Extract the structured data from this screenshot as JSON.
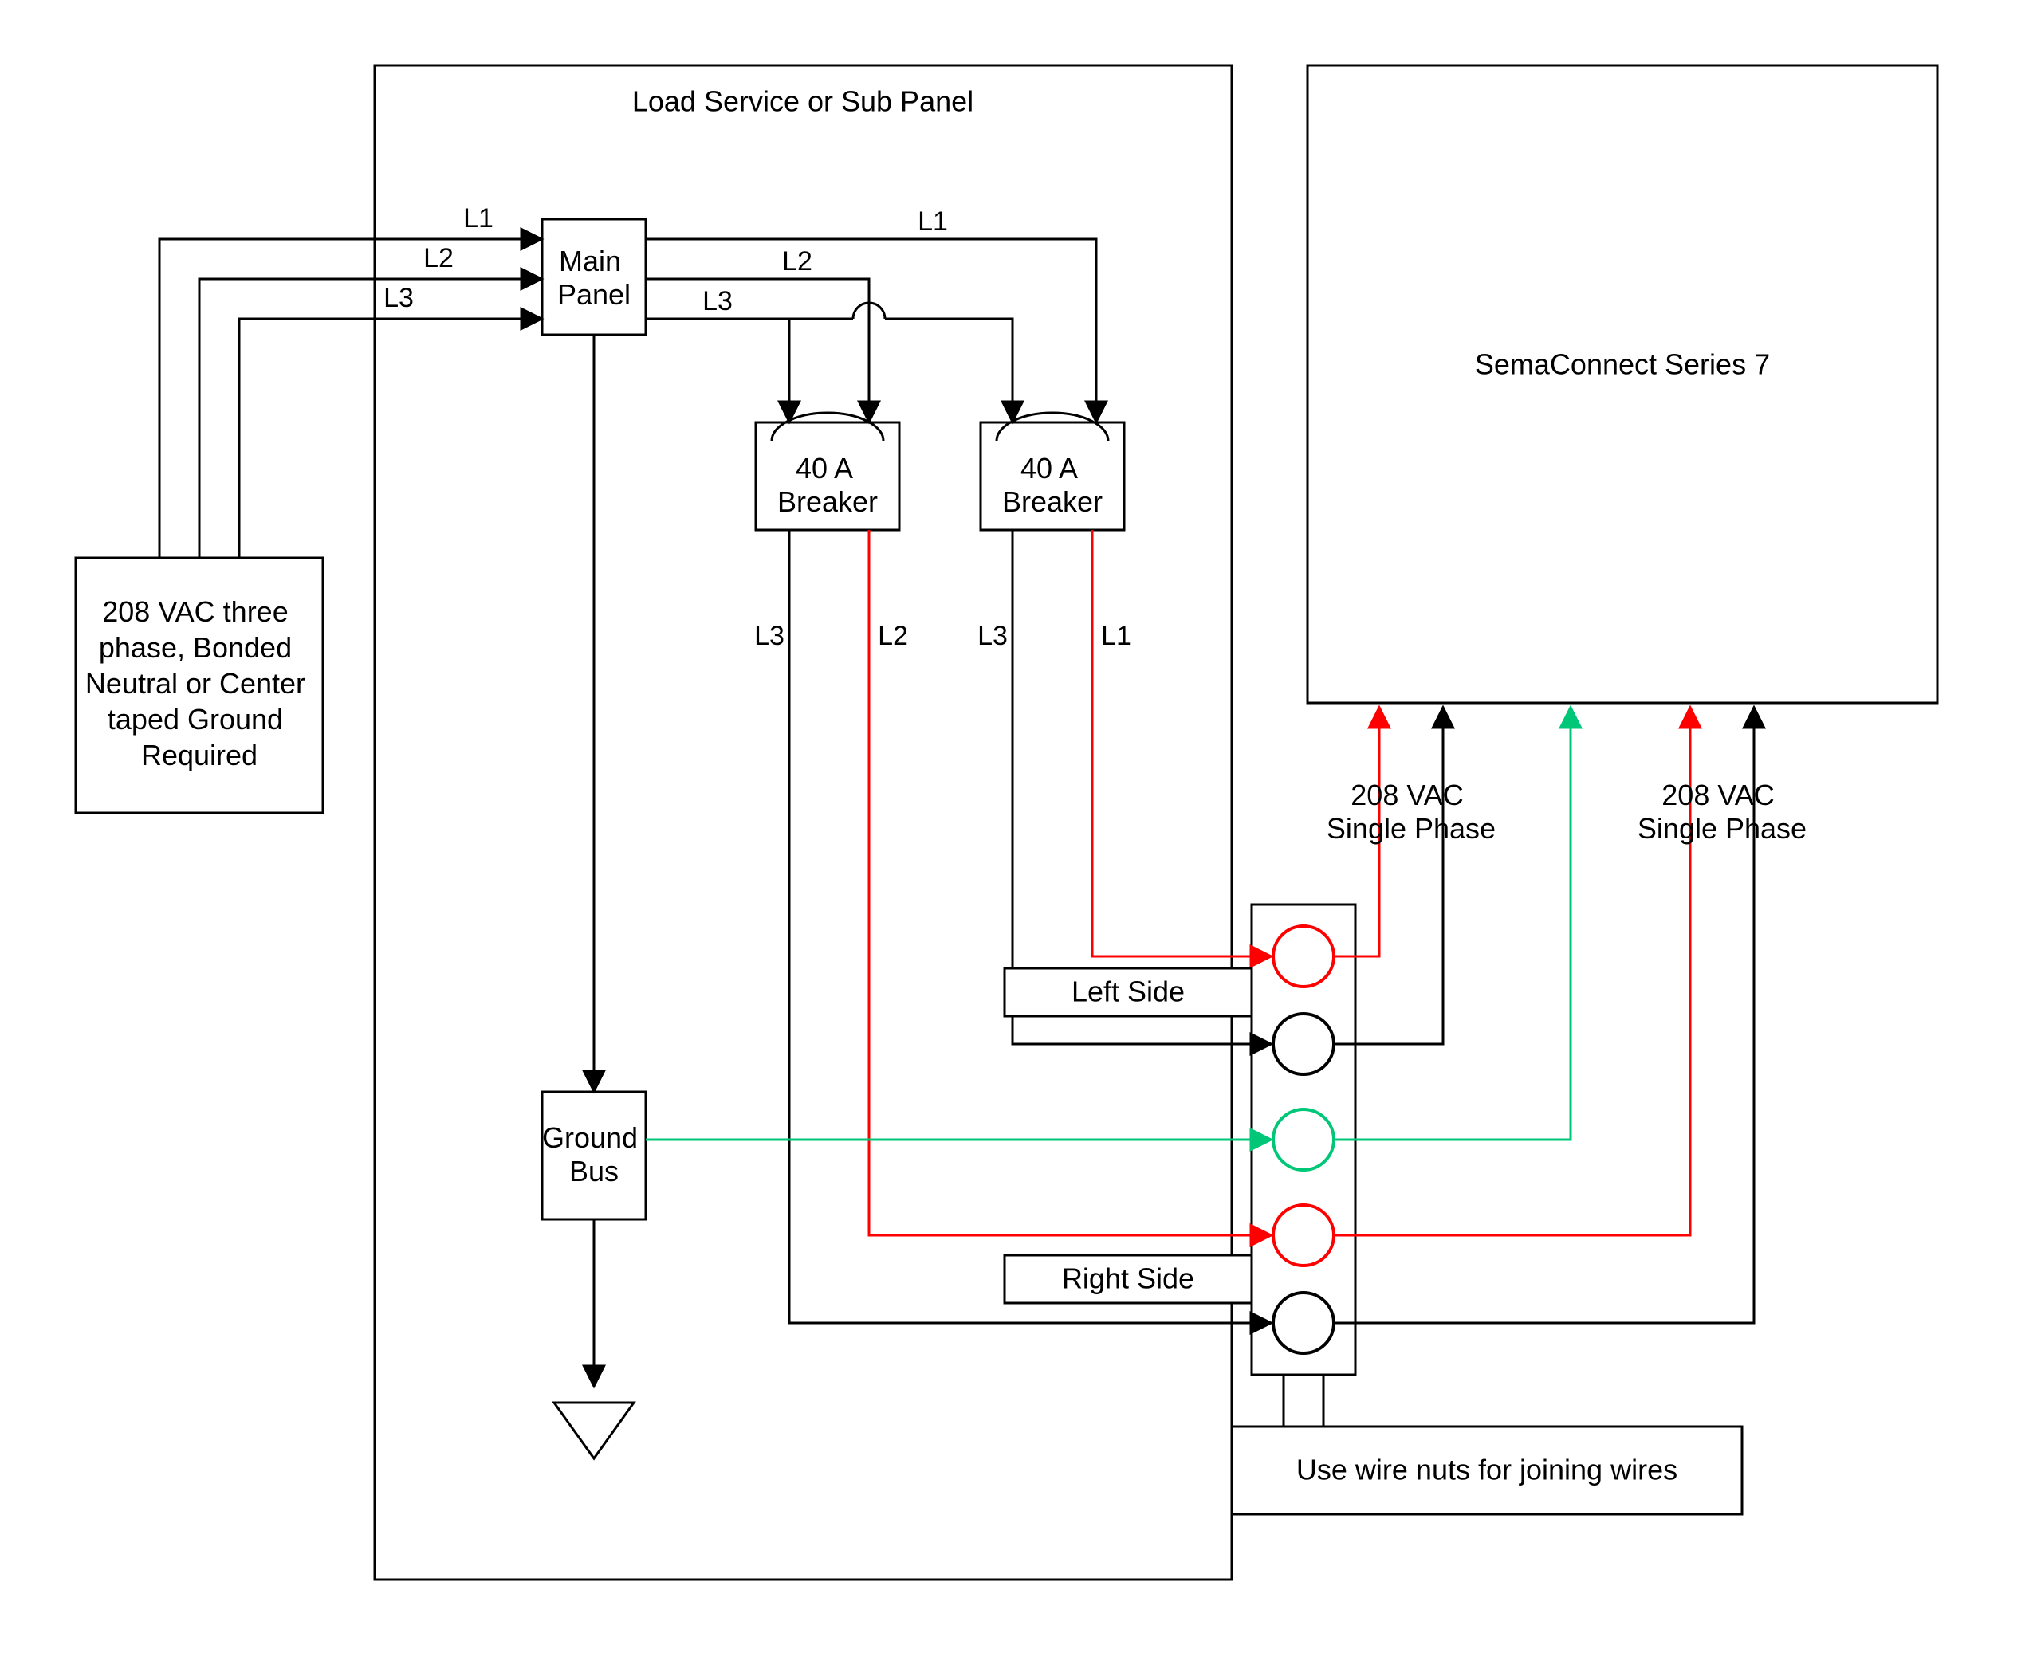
{
  "diagram": {
    "panel_title": "Load Service or Sub Panel",
    "source_box": "208 VAC three phase, Bonded Neutral or Center taped Ground Required",
    "main_panel": "Main Panel",
    "breaker1": "40 A Breaker",
    "breaker2": "40 A Breaker",
    "ground_bus": "Ground Bus",
    "device_box": "SemaConnect Series 7",
    "phase1_label": "208 VAC Single Phase",
    "phase2_label": "208 VAC Single Phase",
    "left_side": "Left Side",
    "right_side": "Right Side",
    "wire_nuts": "Use wire nuts for joining wires",
    "lines": {
      "l1": "L1",
      "l2": "L2",
      "l3": "L3"
    },
    "colors": {
      "black": "#000000",
      "red": "#ff0000",
      "green": "#00c777"
    }
  }
}
